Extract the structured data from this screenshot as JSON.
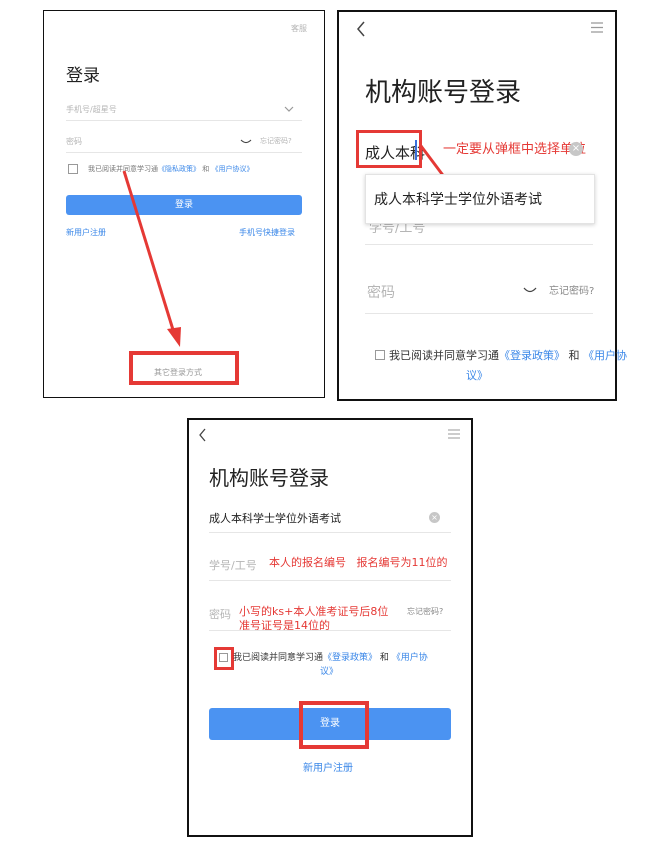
{
  "panel1": {
    "service_link": "客服",
    "title": "登录",
    "phone_placeholder": "手机号/超星号",
    "password_placeholder": "密码",
    "forgot_password": "忘记密码?",
    "agree_prefix": "我已阅读并同意学习通",
    "privacy_link": "《隐私政策》",
    "agree_and": "和",
    "user_agreement_link": "《用户协议》",
    "login_button": "登录",
    "register_link": "新用户注册",
    "quick_login_link": "手机号快捷登录",
    "other_login": "其它登录方式"
  },
  "panel2": {
    "title": "机构账号登录",
    "org_input_value": "成人本科",
    "annotation": "一定要从弹框中选择单位",
    "dropdown_option": "成人本科学士学位外语考试",
    "id_placeholder_partial": "学号/工号",
    "password_placeholder": "密码",
    "forgot_password": "忘记密码?",
    "agree_prefix": "我已阅读并同意学习通",
    "policy_link": "《登录政策》",
    "agree_and": "和",
    "user_agreement_link_a": "《用户协",
    "user_agreement_link_b": "议》"
  },
  "panel3": {
    "title": "机构账号登录",
    "org_value": "成人本科学士学位外语考试",
    "id_placeholder": "学号/工号",
    "id_annotation": "本人的报名编号   报名编号为11位的",
    "password_placeholder": "密码",
    "password_annotation_1": "小写的ks+本人准考证号后8位",
    "password_annotation_2": "准号证号是14位的",
    "forgot_password": "忘记密码?",
    "agree_prefix": "我已阅读并同意学习通",
    "policy_link": "《登录政策》",
    "agree_and": "和",
    "user_agreement_link_a": "《用户协",
    "user_agreement_link_b": "议》",
    "login_button": "登录",
    "register_link": "新用户注册"
  },
  "colors": {
    "annotation_red": "#e53935",
    "primary_blue": "#4b93f2",
    "link_blue": "#3a87e8"
  }
}
